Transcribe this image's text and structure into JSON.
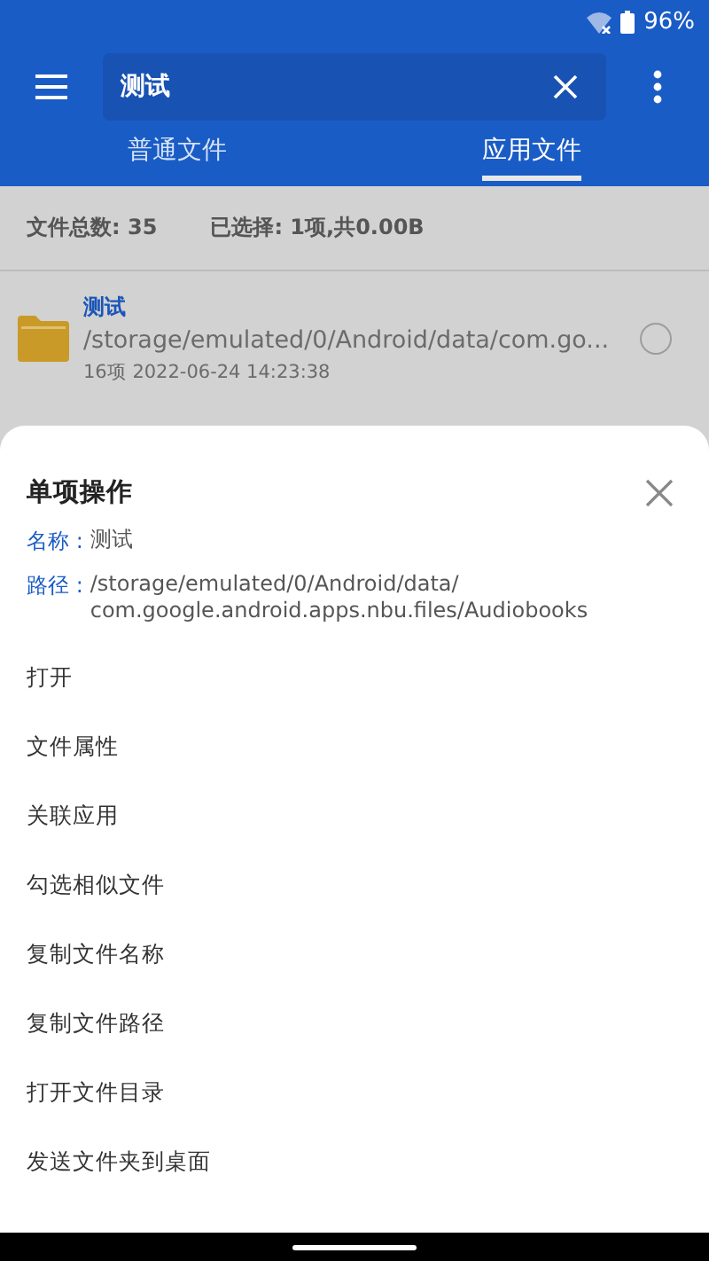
{
  "status_bar": {
    "battery": "96%"
  },
  "toolbar": {
    "search": {
      "value": "测试"
    }
  },
  "tabs": [
    {
      "label": "普通文件",
      "selected": false
    },
    {
      "label": "应用文件",
      "selected": true
    }
  ],
  "summary": {
    "total": "文件总数: 35",
    "selected": "已选择: 1项,共0.00B"
  },
  "files": [
    {
      "name": "测试",
      "path": "/storage/emulated/0/Android/data/com.go...",
      "meta": "16项  2022-06-24 14:23:38",
      "selected": false
    }
  ],
  "sheet": {
    "title": "单项操作",
    "fields": [
      {
        "label": "名称 :",
        "value": "测试"
      },
      {
        "label": "路径 :",
        "value": "/storage/emulated/0/Android/data/\ncom.google.android.apps.nbu.files/Audiobooks"
      }
    ],
    "actions": [
      "打开",
      "文件属性",
      "关联应用",
      "勾选相似文件",
      "复制文件名称",
      "复制文件路径",
      "打开文件目录",
      "发送文件夹到桌面"
    ]
  }
}
